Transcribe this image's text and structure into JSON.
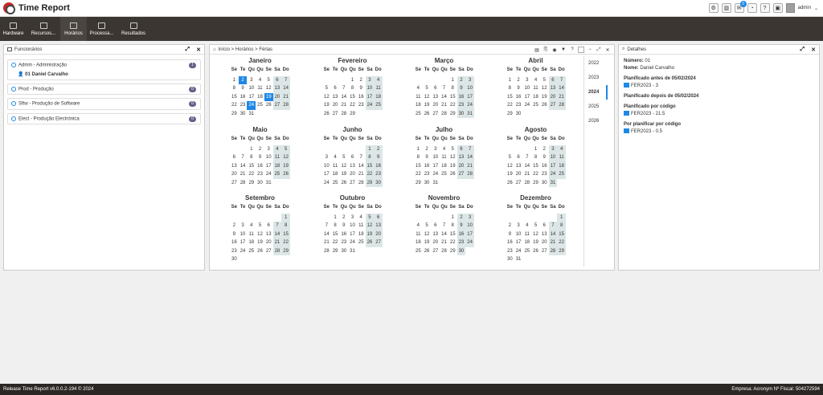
{
  "app": {
    "title": "Time Report",
    "user": "admin"
  },
  "notif_count": "0",
  "menu": [
    {
      "label": "Hardware"
    },
    {
      "label": "Recursos..."
    },
    {
      "label": "Horários"
    },
    {
      "label": "Processa..."
    },
    {
      "label": "Resultados"
    }
  ],
  "left": {
    "title": "Funcionários",
    "groups": [
      {
        "label": "Admin - Administração",
        "count": "1",
        "sub": "01 Daniel Carvalho"
      },
      {
        "label": "Prod - Produção",
        "count": "0"
      },
      {
        "label": "Sftw - Produção de Software",
        "count": "0"
      },
      {
        "label": "Elect - Produção Electrónica",
        "count": "0"
      }
    ]
  },
  "center": {
    "breadcrumb": "Início > Horários > Férias"
  },
  "calendar": {
    "year": 2024,
    "weekdays": [
      "Se",
      "Te",
      "Qu",
      "Qu",
      "Se",
      "Sa",
      "Do"
    ],
    "months": [
      "Janeiro",
      "Fevereiro",
      "Março",
      "Abril",
      "Maio",
      "Junho",
      "Julho",
      "Agosto",
      "Setembro",
      "Outubro",
      "Novembro",
      "Dezembro"
    ],
    "selected_days": [
      {
        "month": 1,
        "day": 2
      },
      {
        "month": 1,
        "day": 19
      },
      {
        "month": 1,
        "day": 24
      }
    ]
  },
  "years": [
    "2022",
    "2023",
    "2024",
    "2025",
    "2026"
  ],
  "active_year": "2024",
  "right": {
    "title": "Detalhes",
    "numero_label": "Número:",
    "numero": "01",
    "nome_label": "Nome:",
    "nome": "Daniel Carvalho",
    "h1": "Planificado antes de 05/02/2024",
    "i1": "FER2023 - 3",
    "h2": "Planificado depois de 05/02/2024",
    "h3": "Planificado por código",
    "i3": "FER2023 - 21.5",
    "h4": "Por planificar por código",
    "i4": "FER2023 - 0.5"
  },
  "footer": {
    "left": "Release Time Report v6.0.0.2-194 © 2024",
    "right": "Empresa: Acronym Nº Fiscal: 504272594"
  }
}
